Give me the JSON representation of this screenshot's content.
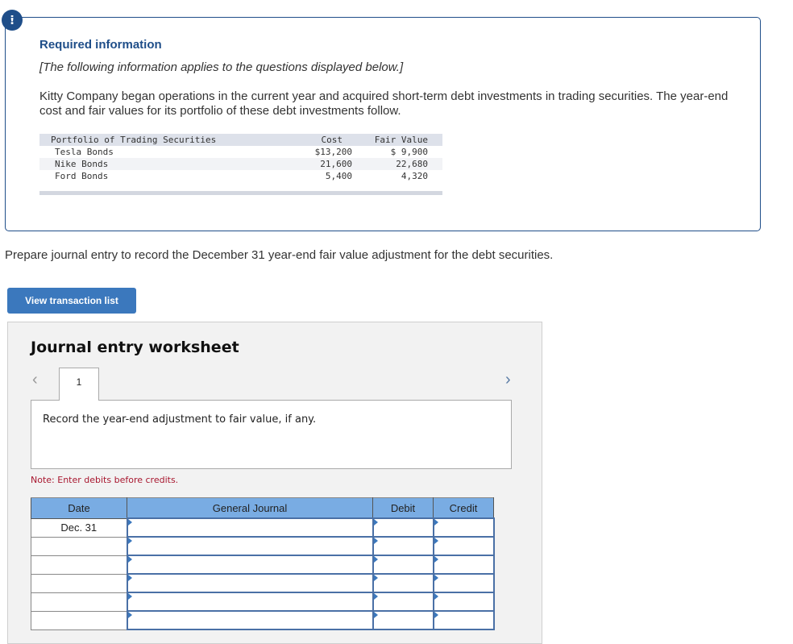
{
  "alert_icon": "exclamation-icon",
  "info": {
    "title": "Required information",
    "subtitle": "[The following information applies to the questions displayed below.]",
    "text": "Kitty Company began operations in the current year and acquired short-term debt investments in trading securities. The year-end cost and fair values for its portfolio of these debt investments follow.",
    "portfolio": {
      "headers": [
        "Portfolio of Trading Securities",
        "Cost",
        "Fair Value"
      ],
      "rows": [
        {
          "name": "Tesla Bonds",
          "cost": "$13,200",
          "fair_value": "$ 9,900"
        },
        {
          "name": "Nike Bonds",
          "cost": "21,600",
          "fair_value": "22,680"
        },
        {
          "name": "Ford Bonds",
          "cost": "5,400",
          "fair_value": "4,320"
        }
      ]
    }
  },
  "prompt": "Prepare journal entry to record the December 31 year-end fair value adjustment for the debt securities.",
  "view_button": "View transaction list",
  "worksheet": {
    "title": "Journal entry worksheet",
    "prev_icon": "chevron-left-icon",
    "next_icon": "chevron-right-icon",
    "tab_label": "1",
    "instruction": "Record the year-end adjustment to fair value, if any.",
    "note": "Note: Enter debits before credits.",
    "table": {
      "headers": [
        "Date",
        "General Journal",
        "Debit",
        "Credit"
      ],
      "rows": [
        {
          "date": "Dec. 31",
          "account": "",
          "debit": "",
          "credit": ""
        },
        {
          "date": "",
          "account": "",
          "debit": "",
          "credit": ""
        },
        {
          "date": "",
          "account": "",
          "debit": "",
          "credit": ""
        },
        {
          "date": "",
          "account": "",
          "debit": "",
          "credit": ""
        },
        {
          "date": "",
          "account": "",
          "debit": "",
          "credit": ""
        },
        {
          "date": "",
          "account": "",
          "debit": "",
          "credit": ""
        }
      ]
    }
  }
}
